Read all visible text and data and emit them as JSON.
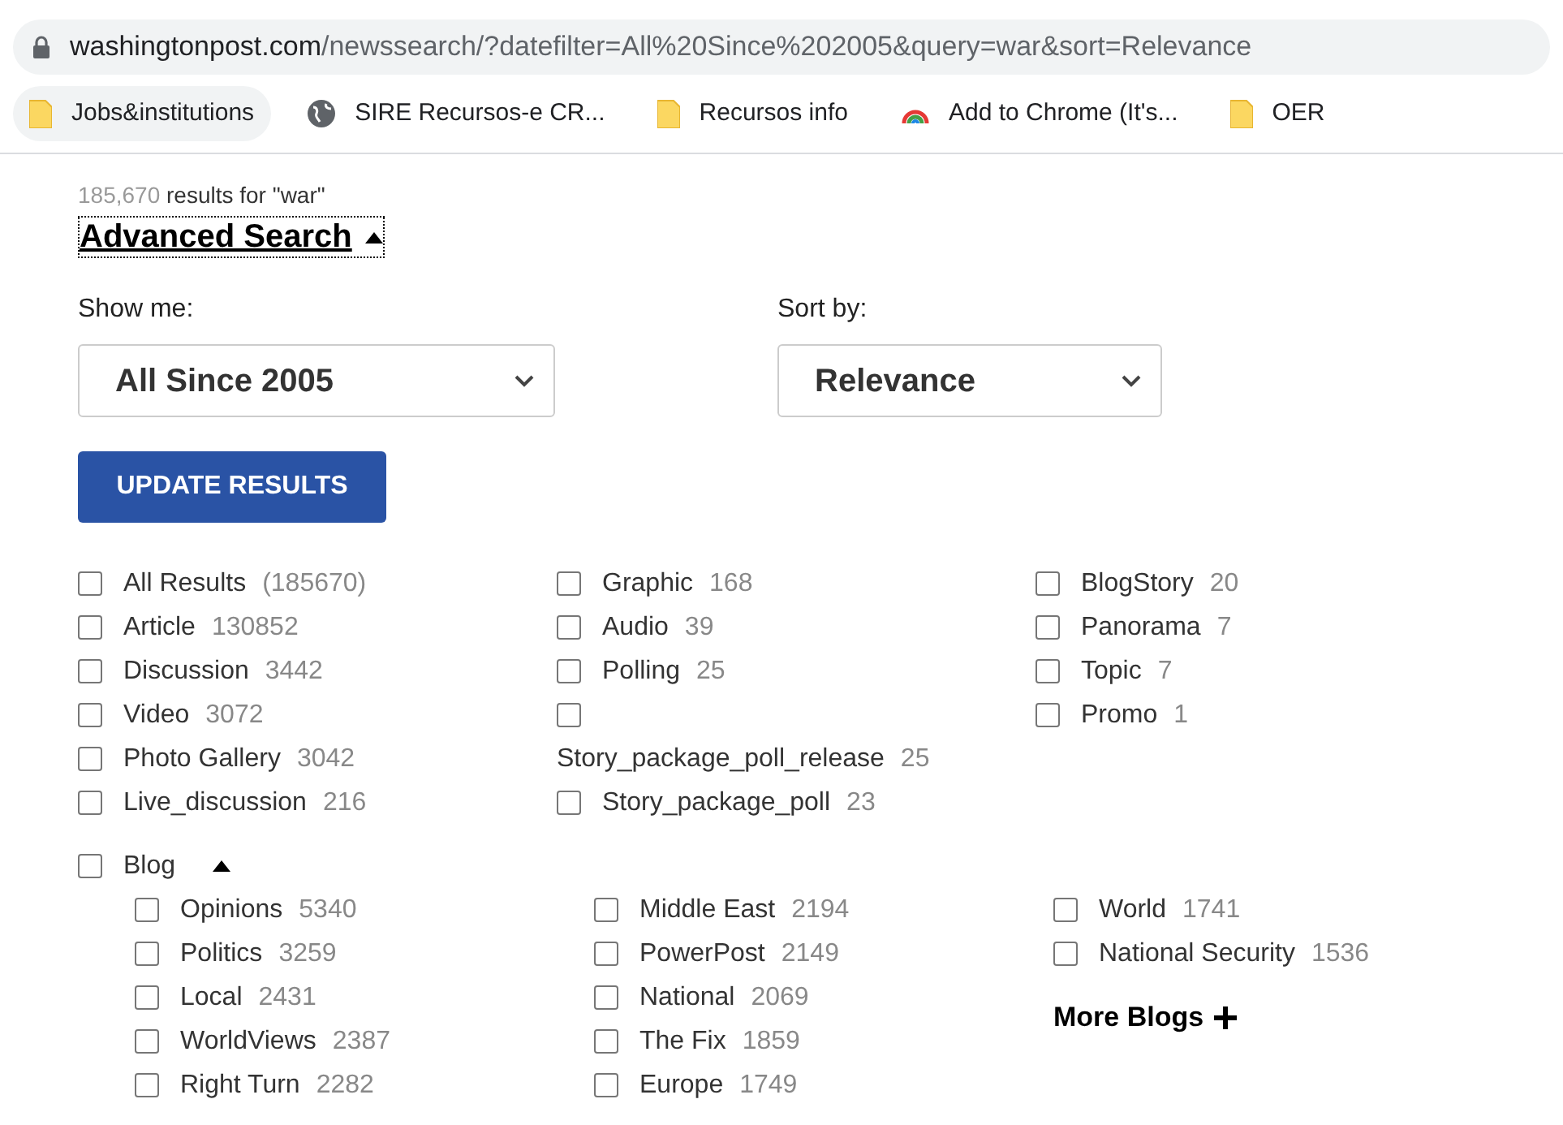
{
  "address_bar": {
    "domain": "washingtonpost.com",
    "path": "/newssearch/?datefilter=All%20Since%202005&query=war&sort=Relevance"
  },
  "bookmarks": [
    {
      "label": "Jobs&institutions",
      "kind": "folder",
      "selected": true
    },
    {
      "label": "SIRE Recursos-e CR...",
      "kind": "globe",
      "selected": false
    },
    {
      "label": "Recursos info",
      "kind": "folder",
      "selected": false
    },
    {
      "label": "Add to Chrome (It's...",
      "kind": "rainbow",
      "selected": false
    },
    {
      "label": "OER",
      "kind": "folder",
      "selected": false
    }
  ],
  "results_summary": {
    "count": "185,670",
    "text": "results for \"war\""
  },
  "advanced_search": {
    "label": "Advanced Search",
    "expanded": true
  },
  "filters": [
    {
      "label": "Show me:",
      "value": "All Since 2005"
    },
    {
      "label": "Sort by:",
      "value": "Relevance"
    }
  ],
  "update_button": "UPDATE RESULTS",
  "type_columns": [
    [
      {
        "label": "All Results",
        "count": "(185670)",
        "checked": false,
        "kind": "inline"
      },
      {
        "label": "Article",
        "count": "130852",
        "checked": false,
        "kind": "inline"
      },
      {
        "label": "Discussion",
        "count": "3442",
        "checked": false,
        "kind": "inline"
      },
      {
        "label": "Video",
        "count": "3072",
        "checked": false,
        "kind": "inline"
      },
      {
        "label": "Photo Gallery",
        "count": "3042",
        "checked": false,
        "kind": "inline"
      },
      {
        "label": "Live_discussion",
        "count": "216",
        "checked": false,
        "kind": "inline"
      }
    ],
    [
      {
        "label": "Graphic",
        "count": "168",
        "checked": false,
        "kind": "inline"
      },
      {
        "label": "Audio",
        "count": "39",
        "checked": false,
        "kind": "inline"
      },
      {
        "label": "Polling",
        "count": "25",
        "checked": false,
        "kind": "inline"
      },
      {
        "label": "Story_package_poll_release",
        "count": "25",
        "checked": false,
        "kind": "wrapped"
      },
      {
        "label": "Story_package_poll",
        "count": "23",
        "checked": false,
        "kind": "inline"
      }
    ],
    [
      {
        "label": "BlogStory",
        "count": "20",
        "checked": false,
        "kind": "inline"
      },
      {
        "label": "Panorama",
        "count": "7",
        "checked": false,
        "kind": "inline"
      },
      {
        "label": "Topic",
        "count": "7",
        "checked": false,
        "kind": "inline"
      },
      {
        "label": "Promo",
        "count": "1",
        "checked": false,
        "kind": "inline"
      }
    ]
  ],
  "blog": {
    "label": "Blog",
    "checked": false,
    "expanded": true,
    "columns": [
      [
        {
          "label": "Opinions",
          "count": "5340",
          "checked": false
        },
        {
          "label": "Politics",
          "count": "3259",
          "checked": false
        },
        {
          "label": "Local",
          "count": "2431",
          "checked": false
        },
        {
          "label": "WorldViews",
          "count": "2387",
          "checked": false
        },
        {
          "label": "Right Turn",
          "count": "2282",
          "checked": false
        }
      ],
      [
        {
          "label": "Middle East",
          "count": "2194",
          "checked": false
        },
        {
          "label": "PowerPost",
          "count": "2149",
          "checked": false
        },
        {
          "label": "National",
          "count": "2069",
          "checked": false
        },
        {
          "label": "The Fix",
          "count": "1859",
          "checked": false
        },
        {
          "label": "Europe",
          "count": "1749",
          "checked": false
        }
      ],
      [
        {
          "label": "World",
          "count": "1741",
          "checked": false
        },
        {
          "label": "National Security",
          "count": "1536",
          "checked": false
        }
      ]
    ],
    "more_link": "More Blogs"
  }
}
